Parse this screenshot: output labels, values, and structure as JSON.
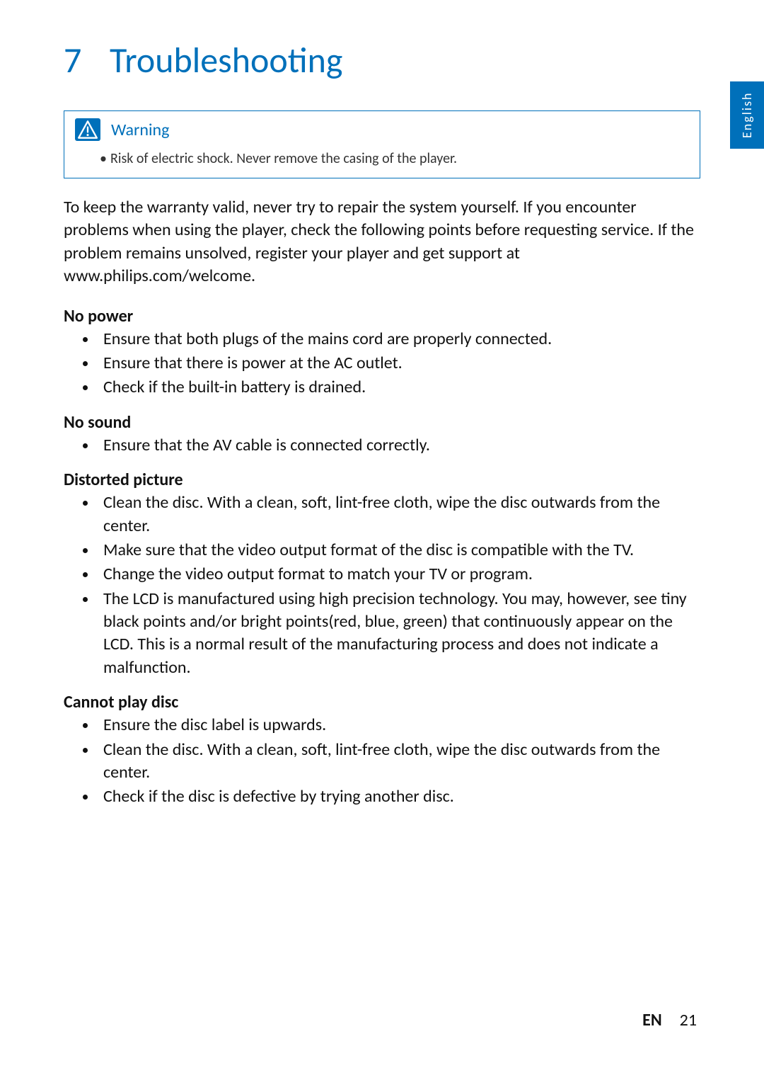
{
  "language_tab": "English",
  "chapter": {
    "number": "7",
    "title": "Troubleshooting"
  },
  "warning": {
    "label": "Warning",
    "text": "Risk of electric shock. Never remove the casing of the player."
  },
  "intro": "To keep the warranty valid, never try to repair the system yourself. If you encounter problems when using the player, check the following points before requesting service. If the problem remains unsolved, register your player and get support at www.philips.com/welcome.",
  "sections": [
    {
      "title": "No power",
      "items": [
        "Ensure that both plugs of the mains cord are properly connected.",
        "Ensure that there is power at the AC outlet.",
        "Check if the built-in battery is drained."
      ]
    },
    {
      "title": "No sound",
      "items": [
        "Ensure that the AV cable is connected correctly."
      ]
    },
    {
      "title": "Distorted picture",
      "items": [
        "Clean the disc. With a clean, soft, lint-free cloth, wipe the disc outwards from the center.",
        "Make sure that the video output format of the disc is compatible with the TV.",
        "Change the video output format to match your TV or program.",
        "The LCD is manufactured using high precision technology. You may, however, see tiny black points and/or bright points(red, blue, green) that continuously appear on the LCD. This is a normal result of the manufacturing process and does not indicate a malfunction."
      ]
    },
    {
      "title": "Cannot play disc",
      "items": [
        "Ensure the disc label is upwards.",
        "Clean the disc. With a clean, soft, lint-free cloth, wipe the disc outwards from the center.",
        "Check if the disc is defective by trying another disc."
      ]
    }
  ],
  "footer": {
    "lang": "EN",
    "page": "21"
  }
}
